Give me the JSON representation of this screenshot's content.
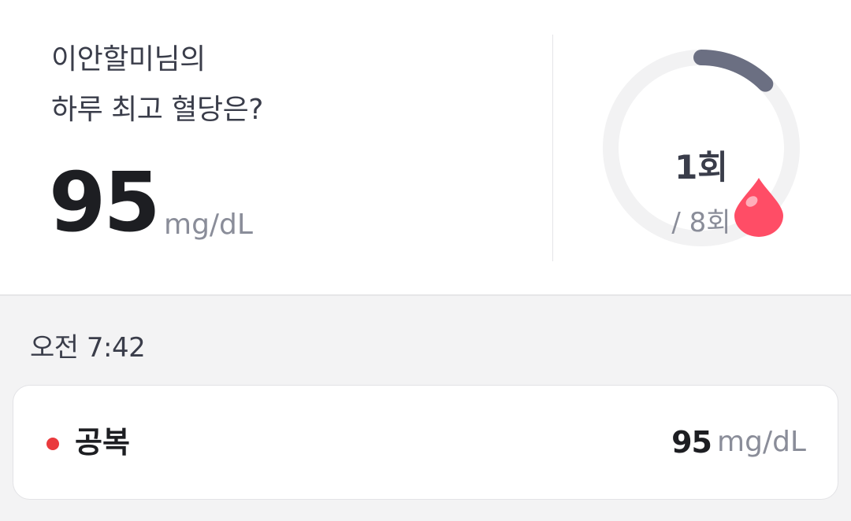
{
  "summary": {
    "title_line1": "이안할미님의",
    "title_line2": "하루 최고 혈당은?",
    "max_value": "95",
    "unit": "mg/dL"
  },
  "gauge": {
    "count_label": "1회",
    "total_label": "/ 8회",
    "progress_fraction": 0.125,
    "track_color": "#f2f2f3",
    "progress_color": "#6b6f82",
    "icon": "blood-drop-icon",
    "icon_color": "#ff4d66"
  },
  "records": {
    "time_label": "오전 7:42",
    "items": [
      {
        "label": "공복",
        "value": "95",
        "unit": "mg/dL",
        "status_color": "#ea3a3d"
      }
    ]
  }
}
